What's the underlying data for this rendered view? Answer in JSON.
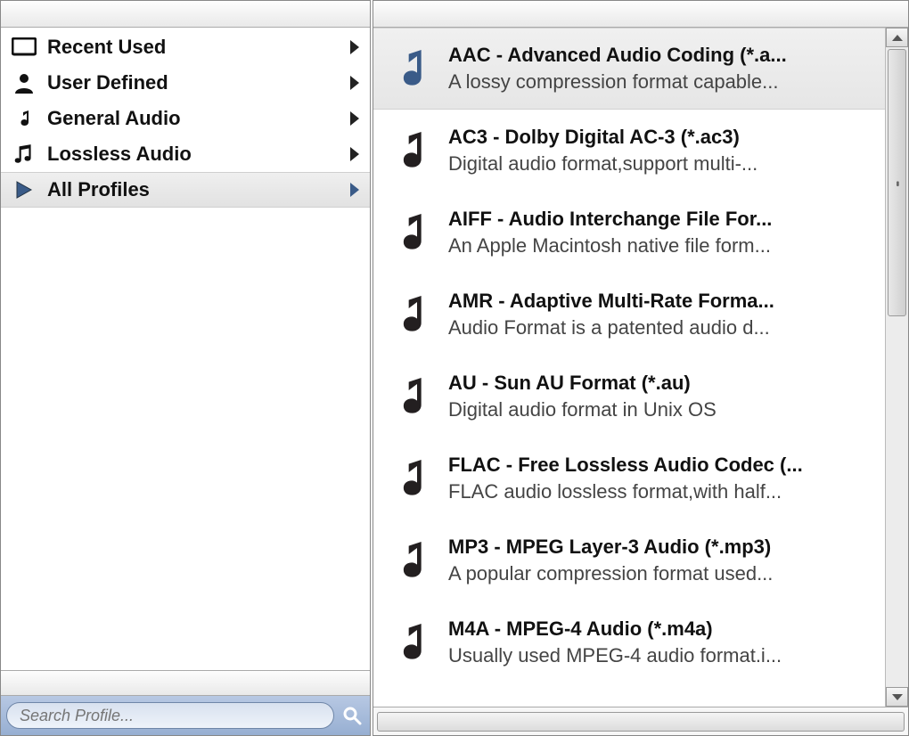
{
  "sidebar": {
    "categories": [
      {
        "label": "Recent Used",
        "icon": "monitor-icon",
        "selected": false
      },
      {
        "label": "User Defined",
        "icon": "person-icon",
        "selected": false
      },
      {
        "label": "General Audio",
        "icon": "music-note-icon",
        "selected": false
      },
      {
        "label": "Lossless Audio",
        "icon": "double-note-icon",
        "selected": false
      },
      {
        "label": "All Profiles",
        "icon": "play-icon",
        "selected": true
      }
    ],
    "search_placeholder": "Search Profile..."
  },
  "profiles": [
    {
      "title": "AAC - Advanced Audio Coding (*.a...",
      "desc": "A lossy compression format capable...",
      "selected": true
    },
    {
      "title": "AC3 - Dolby Digital AC-3 (*.ac3)",
      "desc": "Digital audio format,support multi-...",
      "selected": false
    },
    {
      "title": "AIFF - Audio Interchange File For...",
      "desc": "An Apple Macintosh native file form...",
      "selected": false
    },
    {
      "title": "AMR - Adaptive Multi-Rate Forma...",
      "desc": "Audio Format is a patented audio d...",
      "selected": false
    },
    {
      "title": "AU - Sun AU Format (*.au)",
      "desc": "Digital audio format in Unix OS",
      "selected": false
    },
    {
      "title": "FLAC - Free Lossless Audio Codec (...",
      "desc": "FLAC audio lossless format,with half...",
      "selected": false
    },
    {
      "title": "MP3 - MPEG Layer-3 Audio (*.mp3)",
      "desc": "A popular compression format used...",
      "selected": false
    },
    {
      "title": "M4A - MPEG-4 Audio (*.m4a)",
      "desc": "Usually used MPEG-4 audio format.i...",
      "selected": false
    }
  ],
  "colors": {
    "selected_note": "#3a5b88",
    "note": "#231f20"
  }
}
